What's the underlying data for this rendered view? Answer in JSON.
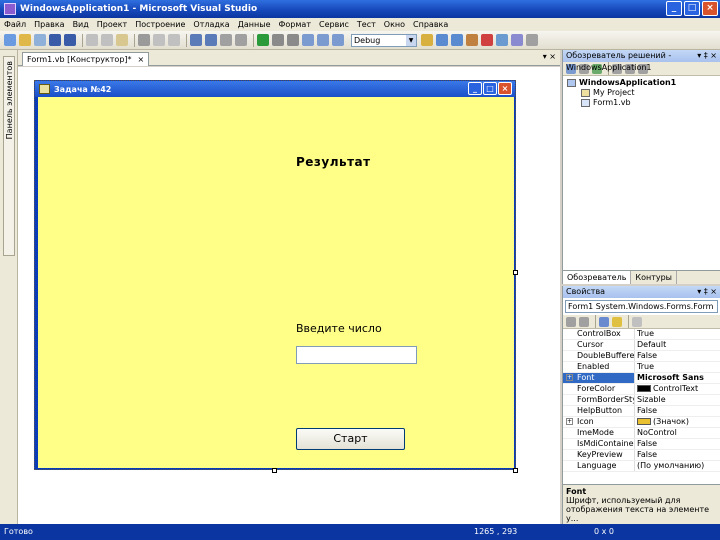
{
  "window": {
    "title": "WindowsApplication1 - Microsoft Visual Studio",
    "minimize": "_",
    "maximize": "□",
    "close": "×"
  },
  "menu": [
    "Файл",
    "Правка",
    "Вид",
    "Проект",
    "Построение",
    "Отладка",
    "Данные",
    "Формат",
    "Сервис",
    "Тест",
    "Окно",
    "Справка"
  ],
  "toolbar": {
    "config": "Debug"
  },
  "toolbox_tab": "Панель элементов",
  "document": {
    "tab_label": "Form1.vb [Конструктор]*",
    "tab_close": "×",
    "pane_controls": "▾ ×"
  },
  "form": {
    "title": "Задача №42",
    "result_label": "Результат",
    "enter_label": "Введите число",
    "input_value": "",
    "start_button": "Старт"
  },
  "solution_explorer": {
    "title": "Обозреватель решений - WindowsApplication1",
    "controls": "▾ ‡ ×",
    "items": [
      {
        "label": "WindowsApplication1"
      },
      {
        "label": "My Project"
      },
      {
        "label": "Form1.vb"
      }
    ],
    "tabs": [
      "Обозреватель",
      "Контуры"
    ]
  },
  "properties": {
    "title": "Свойства",
    "controls": "▾ ‡ ×",
    "object": "Form1 System.Windows.Forms.Form",
    "rows": [
      {
        "name": "ControlBox",
        "value": "True"
      },
      {
        "name": "Cursor",
        "value": "Default"
      },
      {
        "name": "DoubleBuffered",
        "value": "False"
      },
      {
        "name": "Enabled",
        "value": "True"
      },
      {
        "name": "Font",
        "value": "Microsoft Sans"
      },
      {
        "name": "ForeColor",
        "value": "ControlText"
      },
      {
        "name": "FormBorderStyle",
        "value": "Sizable"
      },
      {
        "name": "HelpButton",
        "value": "False"
      },
      {
        "name": "Icon",
        "value": "(Значок)"
      },
      {
        "name": "ImeMode",
        "value": "NoControl"
      },
      {
        "name": "IsMdiContainer",
        "value": "False"
      },
      {
        "name": "KeyPreview",
        "value": "False"
      },
      {
        "name": "Language",
        "value": "(По умолчанию)"
      }
    ],
    "desc_name": "Font",
    "desc_text": "Шрифт, используемый для отображения текста на элементе у..."
  },
  "status": {
    "left": "Готово",
    "position": "1265 , 293",
    "size": "0 x 0"
  },
  "colors": {
    "form_bg": "#ffff88",
    "titlebar": "#1546b8",
    "statusbar": "#0b35a0"
  }
}
